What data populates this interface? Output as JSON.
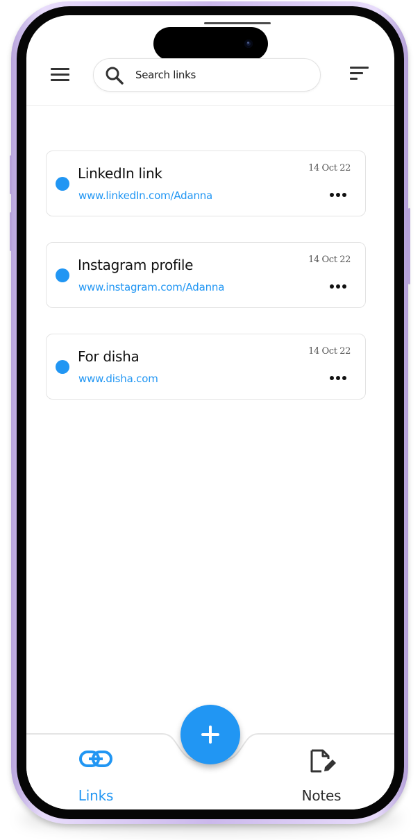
{
  "header": {
    "search_placeholder": "Search links"
  },
  "links": [
    {
      "title": "LinkedIn link",
      "url": "www.linkedIn.com/Adanna",
      "date": "14 Oct 22"
    },
    {
      "title": "Instagram profile",
      "url": "www.instagram.com/Adanna",
      "date": "14 Oct 22"
    },
    {
      "title": "For disha",
      "url": "www.disha.com",
      "date": "14 Oct 22"
    }
  ],
  "bottom_nav": {
    "links_label": "Links",
    "notes_label": "Notes"
  },
  "icons": {
    "menu": "hamburger-menu-icon",
    "search": "search-icon",
    "filter": "sort-filter-icon",
    "more": "more-horizontal-icon",
    "add": "plus-icon",
    "links": "link-icon",
    "notes": "edit-note-icon"
  },
  "colors": {
    "accent": "#2196f3",
    "text": "#111111",
    "card_border": "#e3e3e3"
  }
}
